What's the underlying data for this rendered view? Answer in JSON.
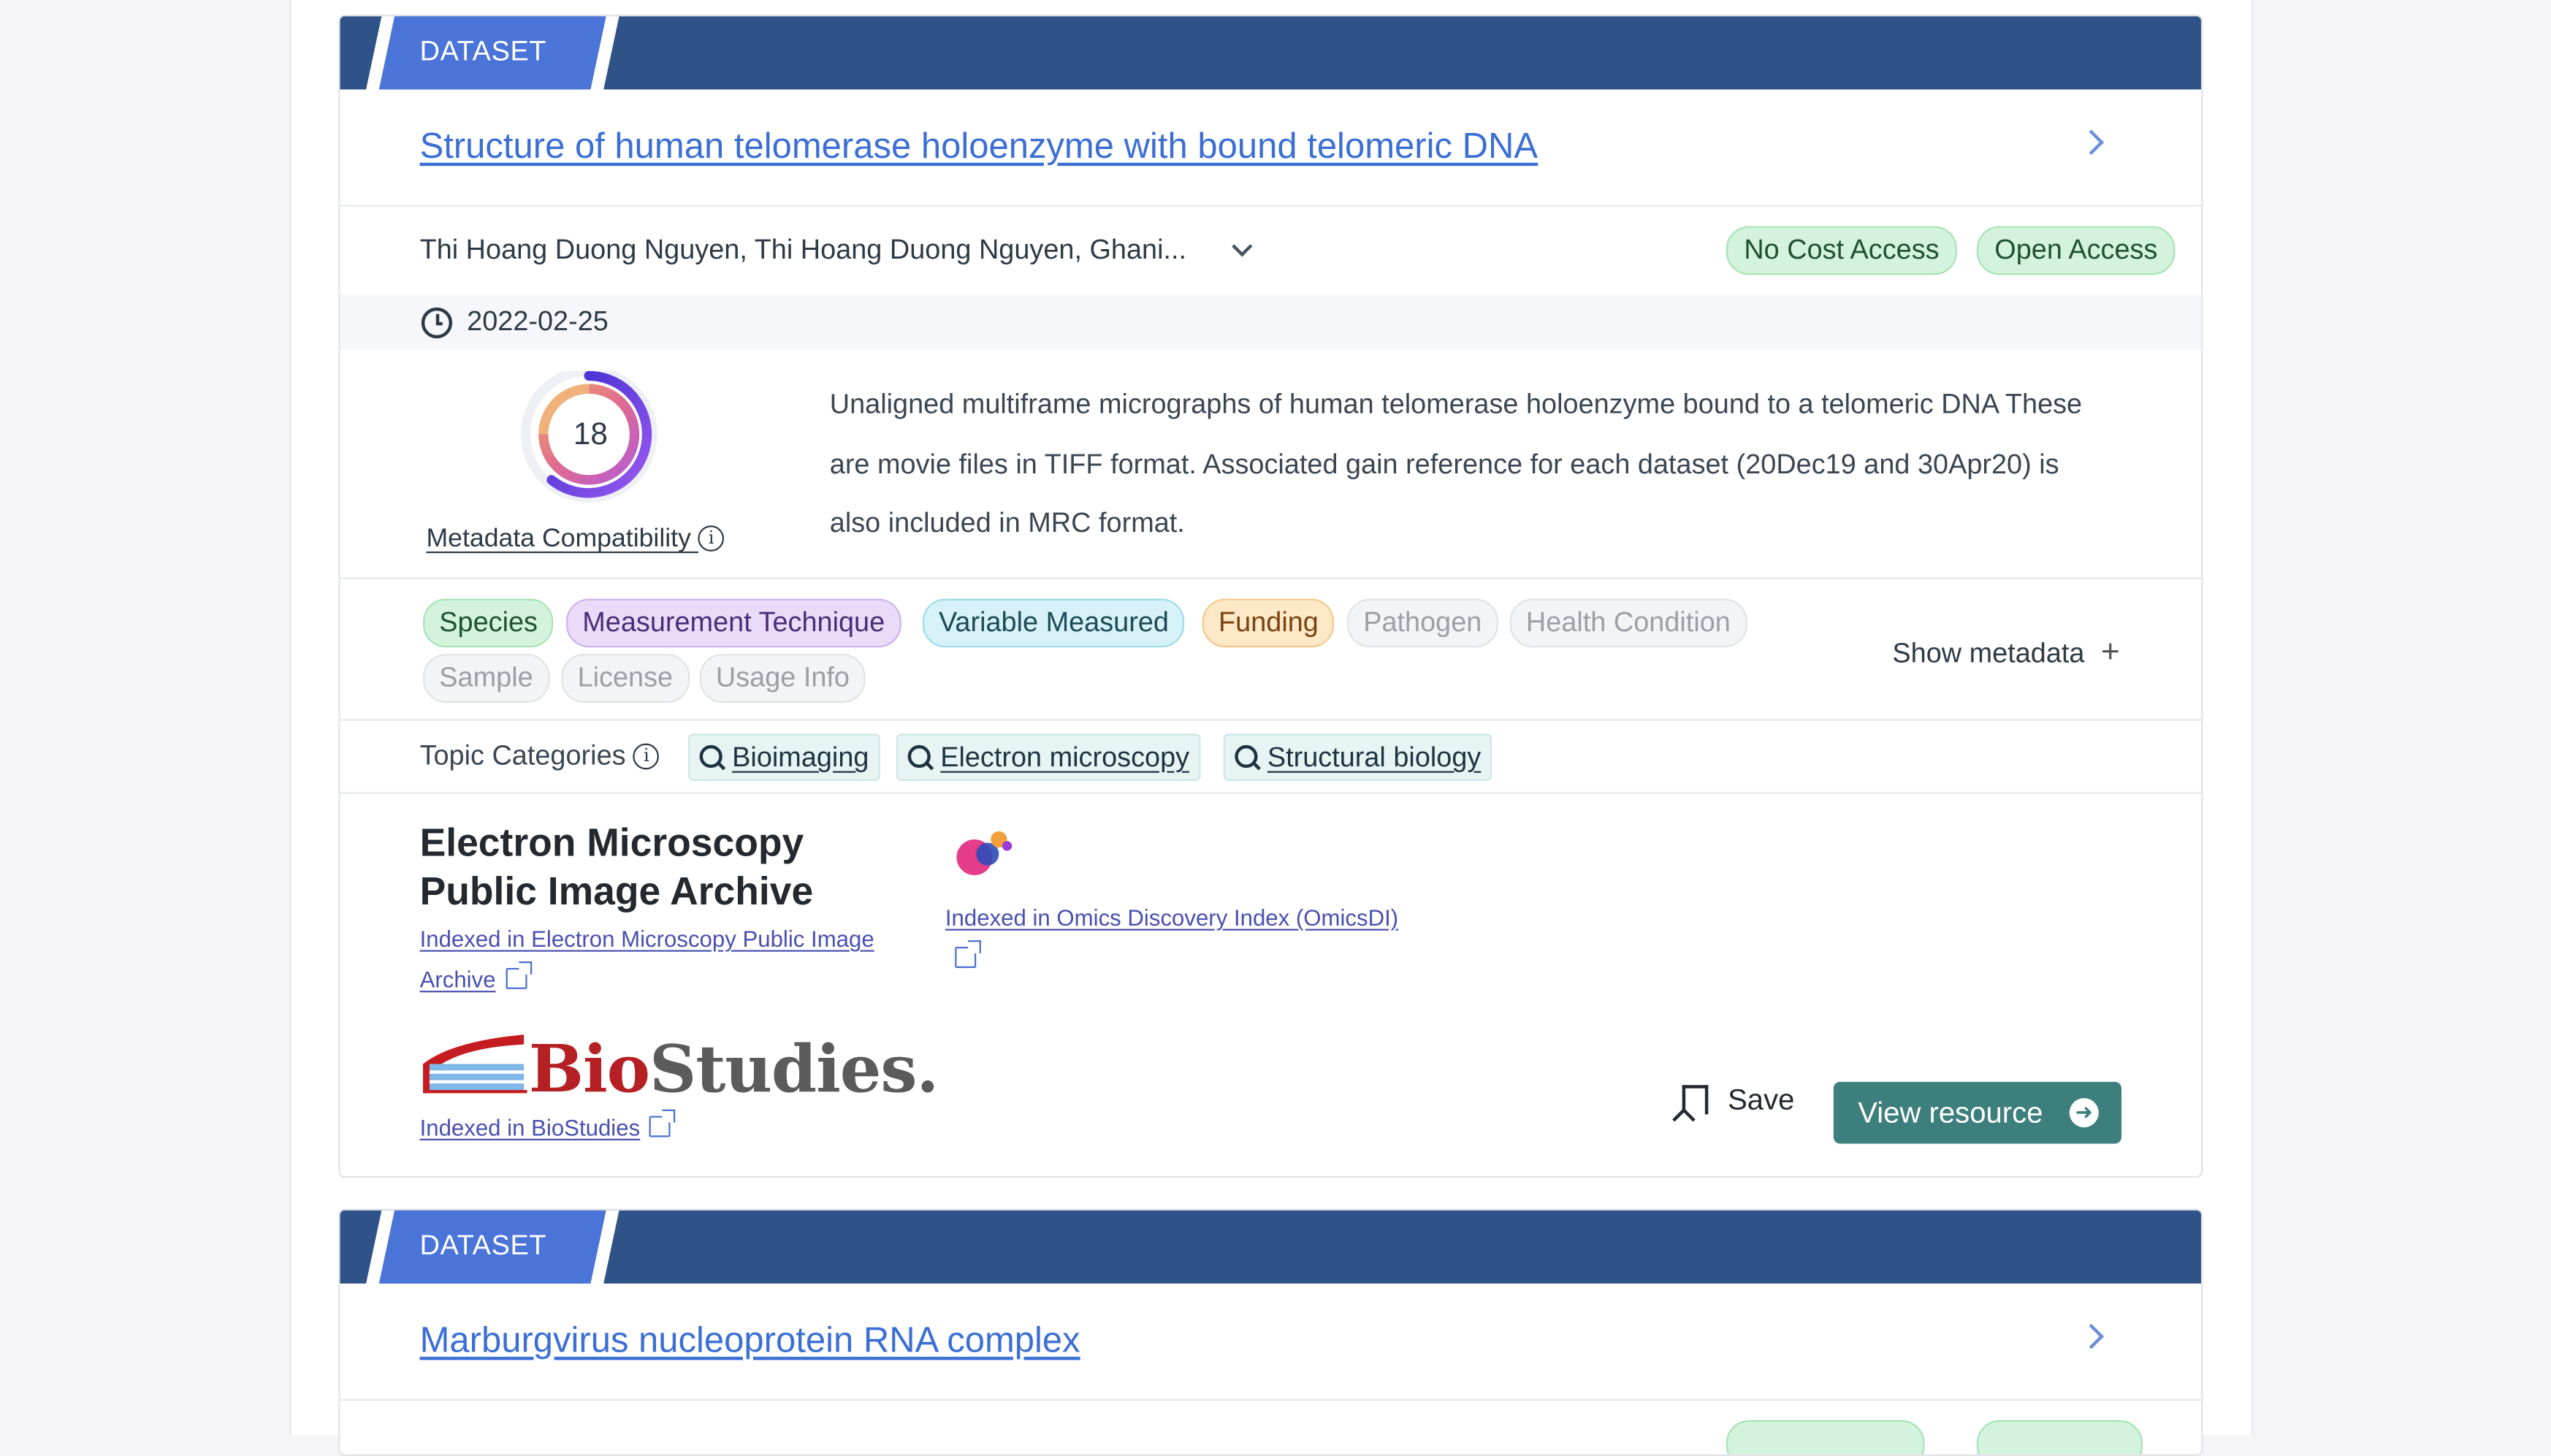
{
  "cards": [
    {
      "type_badge": "DATASET",
      "title": "Structure of human telomerase holoenzyme with bound telomeric DNA",
      "authors": "Thi Hoang Duong Nguyen, Thi Hoang Duong Nguyen, Ghani...",
      "access_badges": [
        "No Cost Access",
        "Open Access"
      ],
      "date": "2022-02-25",
      "metadata_score": "18",
      "metadata_compatibility_label": "Metadata Compatibility",
      "description": "Unaligned multiframe micrographs of human telomerase holoenzyme bound to a telomeric DNA These are movie files in TIFF format. Associated gain reference for each dataset (20Dec19 and 30Apr20) is also included in MRC format.",
      "metadata_tags": [
        {
          "label": "Species",
          "state": "present",
          "color": "#d4f3dc"
        },
        {
          "label": "Measurement Technique",
          "state": "present",
          "color": "#eadcf8"
        },
        {
          "label": "Variable Measured",
          "state": "present",
          "color": "#d6f1f7"
        },
        {
          "label": "Funding",
          "state": "present",
          "color": "#fde8c8"
        },
        {
          "label": "Pathogen",
          "state": "absent",
          "color": "#f3f4f6"
        },
        {
          "label": "Health Condition",
          "state": "absent",
          "color": "#f3f4f6"
        },
        {
          "label": "Sample",
          "state": "absent",
          "color": "#f3f4f6"
        },
        {
          "label": "License",
          "state": "absent",
          "color": "#f3f4f6"
        },
        {
          "label": "Usage Info",
          "state": "absent",
          "color": "#f3f4f6"
        }
      ],
      "show_metadata_label": "Show metadata",
      "topic_categories_label": "Topic Categories",
      "topic_categories": [
        "Bioimaging",
        "Electron microscopy",
        "Structural biology"
      ],
      "sources": {
        "empiar_name": "Electron Microscopy Public Image Archive",
        "empiar_link": "Indexed in Electron Microscopy Public Image Archive",
        "omicsdi_link": "Indexed in Omics Discovery Index (OmicsDI)",
        "biostudies_logo_bio": "Bio",
        "biostudies_logo_rest": "Studies.",
        "biostudies_link": "Indexed in BioStudies"
      },
      "save_label": "Save",
      "view_resource_label": "View resource"
    },
    {
      "type_badge": "DATASET",
      "title": "Marburgvirus nucleoprotein RNA complex"
    }
  ],
  "colors": {
    "header_bar": "#2f5388",
    "badge": "#4b74d9",
    "link": "#3b6fd4",
    "view_button": "#3d7f7c"
  }
}
